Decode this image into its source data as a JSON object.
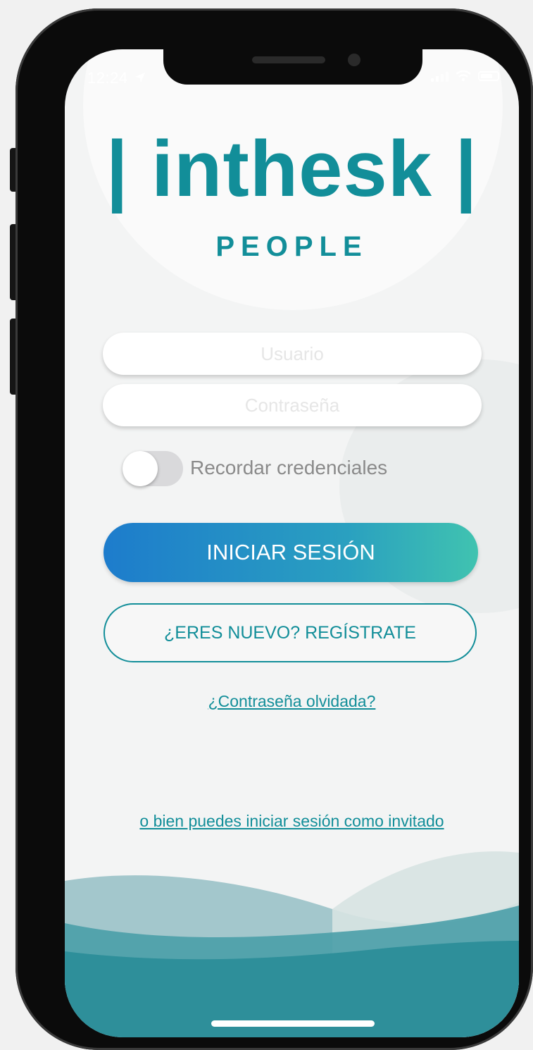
{
  "status_bar": {
    "time": "12:24",
    "location_icon": "location-arrow-icon"
  },
  "logo": {
    "text": "| inthesk |",
    "subtitle": "PEOPLE"
  },
  "form": {
    "username_placeholder": "Usuario",
    "username_value": "",
    "password_placeholder": "Contraseña",
    "password_value": "",
    "remember_label": "Recordar credenciales",
    "remember_on": false
  },
  "buttons": {
    "login": "INICIAR SESIÓN",
    "register": "¿ERES NUEVO? REGÍSTRATE"
  },
  "links": {
    "forgot": "¿Contraseña olvidada?",
    "guest": "o bien puedes iniciar sesión como invitado"
  },
  "colors": {
    "brand": "#128e99",
    "login_gradient_start": "#1d7ccc",
    "login_gradient_end": "#40c3b0",
    "wave": "#2e8f9a"
  }
}
